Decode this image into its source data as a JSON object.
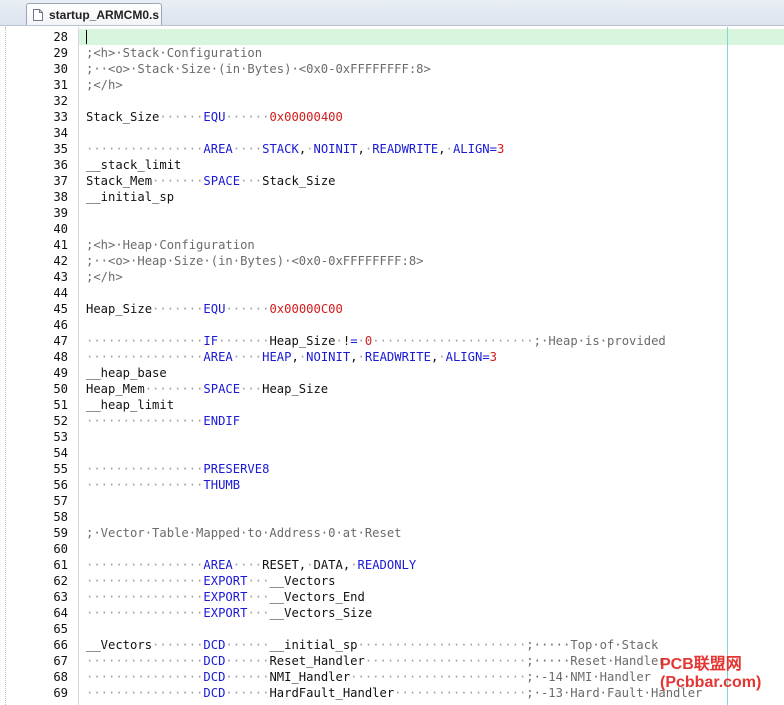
{
  "tab": {
    "label": "startup_ARMCM0.s",
    "icon": "document-icon"
  },
  "editor": {
    "current_line": 28,
    "lines": [
      {
        "n": "28",
        "t": ""
      },
      {
        "n": "29",
        "t": ";<h>·Stack·Configuration"
      },
      {
        "n": "30",
        "t": ";··<o>·Stack·Size·(in·Bytes)·<0x0-0xFFFFFFFF:8>"
      },
      {
        "n": "31",
        "t": ";</h>"
      },
      {
        "n": "32",
        "t": ""
      },
      {
        "n": "33",
        "t": "Stack_Size······EQU······0x00000400"
      },
      {
        "n": "34",
        "t": ""
      },
      {
        "n": "35",
        "t": "················AREA····STACK,·NOINIT,·READWRITE,·ALIGN=3"
      },
      {
        "n": "36",
        "t": "__stack_limit"
      },
      {
        "n": "37",
        "t": "Stack_Mem·······SPACE···Stack_Size"
      },
      {
        "n": "38",
        "t": "__initial_sp"
      },
      {
        "n": "39",
        "t": ""
      },
      {
        "n": "40",
        "t": ""
      },
      {
        "n": "41",
        "t": ";<h>·Heap·Configuration"
      },
      {
        "n": "42",
        "t": ";··<o>·Heap·Size·(in·Bytes)·<0x0-0xFFFFFFFF:8>"
      },
      {
        "n": "43",
        "t": ";</h>"
      },
      {
        "n": "44",
        "t": ""
      },
      {
        "n": "45",
        "t": "Heap_Size·······EQU······0x00000C00"
      },
      {
        "n": "46",
        "t": ""
      },
      {
        "n": "47",
        "t": "················IF·······Heap_Size·!=·0······················;·Heap·is·provided"
      },
      {
        "n": "48",
        "t": "················AREA····HEAP,·NOINIT,·READWRITE,·ALIGN=3"
      },
      {
        "n": "49",
        "t": "__heap_base"
      },
      {
        "n": "50",
        "t": "Heap_Mem········SPACE···Heap_Size"
      },
      {
        "n": "51",
        "t": "__heap_limit"
      },
      {
        "n": "52",
        "t": "················ENDIF"
      },
      {
        "n": "53",
        "t": ""
      },
      {
        "n": "54",
        "t": ""
      },
      {
        "n": "55",
        "t": "················PRESERVE8"
      },
      {
        "n": "56",
        "t": "················THUMB"
      },
      {
        "n": "57",
        "t": ""
      },
      {
        "n": "58",
        "t": ""
      },
      {
        "n": "59",
        "t": ";·Vector·Table·Mapped·to·Address·0·at·Reset"
      },
      {
        "n": "60",
        "t": ""
      },
      {
        "n": "61",
        "t": "················AREA····RESET,·DATA,·READONLY"
      },
      {
        "n": "62",
        "t": "················EXPORT···__Vectors"
      },
      {
        "n": "63",
        "t": "················EXPORT···__Vectors_End"
      },
      {
        "n": "64",
        "t": "················EXPORT···__Vectors_Size"
      },
      {
        "n": "65",
        "t": ""
      },
      {
        "n": "66",
        "t": "__Vectors·······DCD······__initial_sp·······················;·····Top·of·Stack"
      },
      {
        "n": "67",
        "t": "················DCD······Reset_Handler······················;·····Reset·Handler"
      },
      {
        "n": "68",
        "t": "················DCD······NMI_Handler························;·-14·NMI·Handler"
      },
      {
        "n": "69",
        "t": "················DCD······HardFault_Handler··················;·-13·Hard·Fault·Handler"
      }
    ]
  },
  "colors": {
    "comment": "#6b6b6b",
    "keyword": "#1a1ad6",
    "number": "#d41c1c",
    "current_line_bg": "#d8f6de",
    "margin_guide": "#7fd7d0"
  },
  "watermark": "PCB联盟网(Pcbbar.com)"
}
